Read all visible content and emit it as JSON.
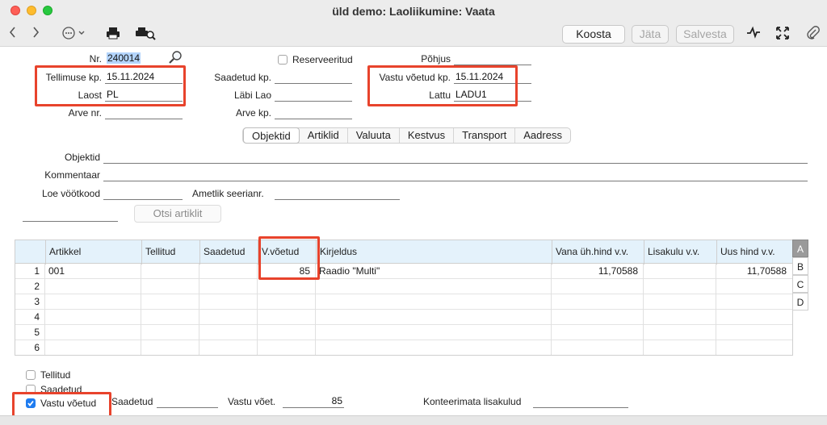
{
  "window": {
    "title": "üld demo: Laoliikumine: Vaata"
  },
  "toolbar": {
    "back_icon": "chevron-left-icon",
    "forward_icon": "chevron-right-icon",
    "more_icon": "ellipsis-circle-icon",
    "print_icon": "printer-icon",
    "print_preview_icon": "print-preview-icon",
    "koosta_label": "Koosta",
    "jata_label": "Jäta",
    "salvesta_label": "Salvesta",
    "activity_icon": "activity-icon",
    "expand_icon": "expand-icon",
    "attach_icon": "paperclip-icon"
  },
  "header": {
    "nr_label": "Nr.",
    "nr_value": "240014",
    "reserveeritud_label": "Reserveeritud",
    "reserveeritud_checked": false,
    "pohjus_label": "Põhjus",
    "pohjus_value": "",
    "tellimuse_kp_label": "Tellimuse kp.",
    "tellimuse_kp_value": "15.11.2024",
    "saadetud_kp_label": "Saadetud kp.",
    "saadetud_kp_value": "",
    "vastu_voetud_kp_label": "Vastu võetud kp.",
    "vastu_voetud_kp_value": "15.11.2024",
    "laost_label": "Laost",
    "laost_value": "PL",
    "labi_lao_label": "Läbi Lao",
    "labi_lao_value": "",
    "lattu_label": "Lattu",
    "lattu_value": "LADU1",
    "arve_nr_label": "Arve nr.",
    "arve_nr_value": "",
    "arve_kp_label": "Arve kp.",
    "arve_kp_value": ""
  },
  "tabs": [
    {
      "label": "Objektid",
      "active": true
    },
    {
      "label": "Artiklid",
      "active": false
    },
    {
      "label": "Valuuta",
      "active": false
    },
    {
      "label": "Kestvus",
      "active": false
    },
    {
      "label": "Transport",
      "active": false
    },
    {
      "label": "Aadress",
      "active": false
    }
  ],
  "details": {
    "objektid_label": "Objektid",
    "kommentaar_label": "Kommentaar",
    "loe_vootkood_label": "Loe vöötkood",
    "ametlik_seerianr_label": "Ametlik seerianr.",
    "otsi_artiklit_label": "Otsi artiklit"
  },
  "grid": {
    "columns": [
      "",
      "Artikkel",
      "Tellitud",
      "Saadetud",
      "V.võetud",
      "Kirjeldus",
      "Vana üh.hind v.v.",
      "Lisakulu v.v.",
      "Uus hind v.v."
    ],
    "rows": [
      [
        "1",
        "001",
        "",
        "",
        "85",
        "Raadio \"Multi\"",
        "11,70588",
        "",
        "11,70588"
      ],
      [
        "2",
        "",
        "",
        "",
        "",
        "",
        "",
        "",
        ""
      ],
      [
        "3",
        "",
        "",
        "",
        "",
        "",
        "",
        "",
        ""
      ],
      [
        "4",
        "",
        "",
        "",
        "",
        "",
        "",
        "",
        ""
      ],
      [
        "5",
        "",
        "",
        "",
        "",
        "",
        "",
        "",
        ""
      ],
      [
        "6",
        "",
        "",
        "",
        "",
        "",
        "",
        "",
        ""
      ]
    ],
    "side_tabs": [
      "A",
      "B",
      "C",
      "D"
    ],
    "active_side_tab": "A"
  },
  "footer": {
    "tellitud_label": "Tellitud",
    "tellitud_checked": false,
    "saadetud_label": "Saadetud",
    "saadetud_checked": false,
    "vastu_voetud_label": "Vastu võetud",
    "vastu_voetud_checked": true,
    "saadetud_field_label": "Saadetud",
    "saadetud_field_value": "",
    "vastu_voet_label": "Vastu võet.",
    "vastu_voet_value": "85",
    "konteerimata_label": "Konteerimata lisakulud",
    "konteerimata_value": ""
  },
  "colors": {
    "highlight_box": "#e8432c",
    "grid_header": "#e4f2fb",
    "checkbox_on": "#1f7cf0"
  }
}
